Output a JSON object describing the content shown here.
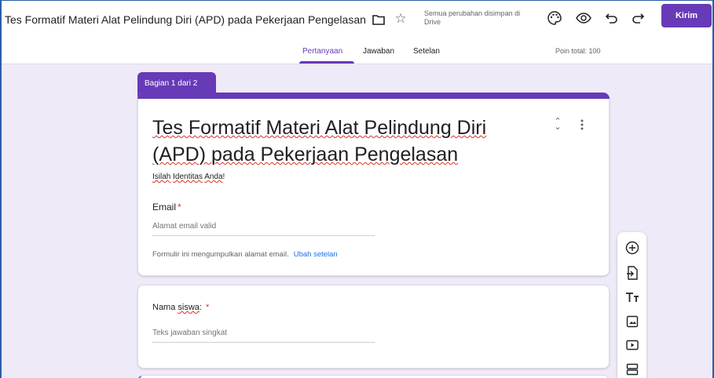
{
  "header": {
    "doc_title": "Tes Formatif Materi Alat Pelindung Diri (APD) pada Pekerjaan Pengelasan",
    "save_status": "Semua perubahan disimpan di Drive",
    "send_label": "Kirim",
    "icons": [
      "folder-icon",
      "star-icon",
      "palette-icon",
      "eye-icon",
      "undo-icon",
      "redo-icon"
    ]
  },
  "tabs": {
    "questions": "Pertanyaan",
    "answers": "Jawaban",
    "settings": "Setelan",
    "points_total": "Poin total: 100"
  },
  "section_badge": "Bagian 1 dari 2",
  "form": {
    "title": "Tes Formatif Materi Alat Pelindung Diri (APD) pada Pekerjaan Pengelasan",
    "desc_a": "Isilah",
    "desc_b": "Identitas",
    "desc_c": "Anda",
    "desc_d": "!",
    "email_label": "Email",
    "required_mark": "*",
    "email_placeholder": "Alamat email valid",
    "email_note": "Formulir ini mengumpulkan alamat email.",
    "email_link": "Ubah setelan"
  },
  "question1": {
    "label_a": "Nama",
    "label_b": "siswa",
    "label_c": ":",
    "required_mark": "*",
    "placeholder": "Teks jawaban singkat"
  },
  "colors": {
    "accent": "#673ab7",
    "background": "#efeaf7",
    "required": "#d93025",
    "link": "#1a73e8"
  }
}
